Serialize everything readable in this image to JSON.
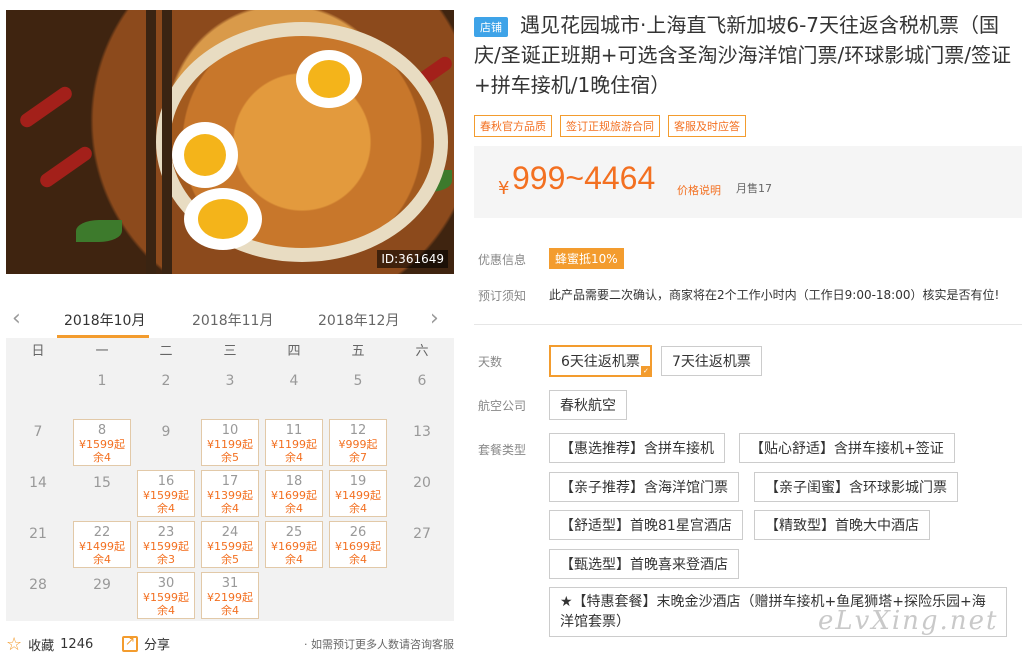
{
  "photo": {
    "id_label": "ID:361649"
  },
  "calendar": {
    "months": [
      "2018年10月",
      "2018年11月",
      "2018年12月"
    ],
    "weekdays": [
      "日",
      "一",
      "二",
      "三",
      "四",
      "五",
      "六"
    ],
    "cells": [
      {
        "d": ""
      },
      {
        "d": "1"
      },
      {
        "d": "2"
      },
      {
        "d": "3"
      },
      {
        "d": "4"
      },
      {
        "d": "5"
      },
      {
        "d": "6"
      },
      {
        "d": "7"
      },
      {
        "d": "8",
        "p": "¥1599起",
        "r": "余4"
      },
      {
        "d": "9"
      },
      {
        "d": "10",
        "p": "¥1199起",
        "r": "余5"
      },
      {
        "d": "11",
        "p": "¥1199起",
        "r": "余4"
      },
      {
        "d": "12",
        "p": "¥999起",
        "r": "余7"
      },
      {
        "d": "13"
      },
      {
        "d": "14"
      },
      {
        "d": "15"
      },
      {
        "d": "16",
        "p": "¥1599起",
        "r": "余4"
      },
      {
        "d": "17",
        "p": "¥1399起",
        "r": "余4"
      },
      {
        "d": "18",
        "p": "¥1699起",
        "r": "余4"
      },
      {
        "d": "19",
        "p": "¥1499起",
        "r": "余4"
      },
      {
        "d": "20"
      },
      {
        "d": "21"
      },
      {
        "d": "22",
        "p": "¥1499起",
        "r": "余4"
      },
      {
        "d": "23",
        "p": "¥1599起",
        "r": "余3"
      },
      {
        "d": "24",
        "p": "¥1599起",
        "r": "余5"
      },
      {
        "d": "25",
        "p": "¥1699起",
        "r": "余4"
      },
      {
        "d": "26",
        "p": "¥1699起",
        "r": "余4"
      },
      {
        "d": "27"
      },
      {
        "d": "28"
      },
      {
        "d": "29"
      },
      {
        "d": "30",
        "p": "¥1599起",
        "r": "余4"
      },
      {
        "d": "31",
        "p": "¥2199起",
        "r": "余4"
      },
      {
        "d": ""
      },
      {
        "d": ""
      },
      {
        "d": ""
      }
    ]
  },
  "bottom": {
    "favorite_label": "收藏",
    "favorite_count": "1246",
    "share_label": "分享",
    "note": "· 如需预订更多人数请咨询客服"
  },
  "product": {
    "shop_badge": "店铺",
    "title": "遇见花园城市·上海直飞新加坡6-7天往返含税机票（国庆/圣诞正班期+可选含圣淘沙海洋馆门票/环球影城门票/签证+拼车接机/1晚住宿）",
    "tags": [
      "春秋官方品质",
      "签订正规旅游合同",
      "客服及时应答"
    ],
    "price_currency": "¥",
    "price_range": "999~4464",
    "price_explain": "价格说明",
    "monthly_sales": "月售17"
  },
  "info": {
    "promo_label": "优惠信息",
    "promo_badge": "蜂蜜抵10%",
    "notice_label": "预订须知",
    "notice_text": "此产品需要二次确认，商家将在2个工作小时内（工作日9:00-18:00）核实是否有位!"
  },
  "options": {
    "days_label": "天数",
    "days": [
      "6天往返机票",
      "7天往返机票"
    ],
    "airline_label": "航空公司",
    "airline": "春秋航空",
    "package_label": "套餐类型",
    "packages": [
      "【惠选推荐】含拼车接机",
      "【贴心舒适】含拼车接机+签证",
      "【亲子推荐】含海洋馆门票",
      "【亲子闺蜜】含环球影城门票",
      "【舒适型】首晚81星宫酒店",
      "【精致型】首晚大中酒店",
      "【甄选型】首晚喜来登酒店",
      "★【特惠套餐】末晚金沙酒店（赠拼车接机+鱼尾狮塔+探险乐园+海洋馆套票）"
    ]
  },
  "watermark": "eLvXing.net",
  "colors": {
    "accent": "#f39c2e",
    "price": "#f37021",
    "shop_badge": "#3ea3e8"
  }
}
